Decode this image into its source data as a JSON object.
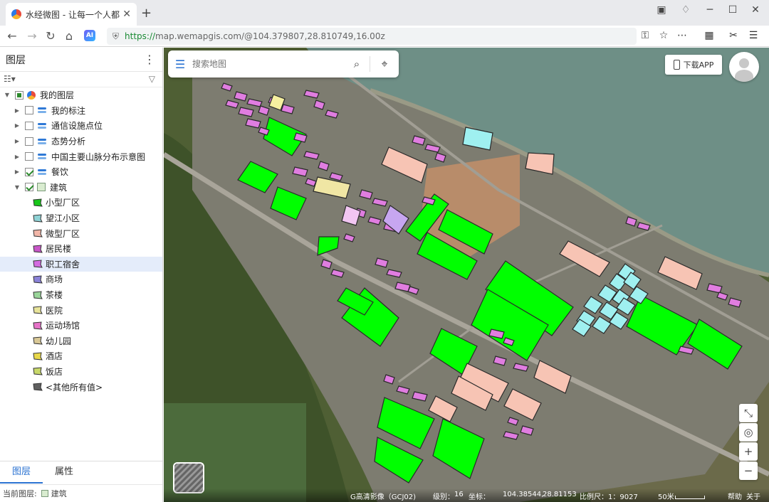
{
  "browser": {
    "tab_title": "水经微图 - 让每一个人都有自",
    "url_protocol": "https://",
    "url_rest": "map.wemapgis.com/@104.379807,28.810749,16.00z",
    "ai_badge": "AI"
  },
  "panel": {
    "title": "图层",
    "tree": [
      {
        "label": "我的图层",
        "level": 0,
        "check": "part",
        "icon": "globe"
      },
      {
        "label": "我的标注",
        "level": 1,
        "check": "off",
        "icon": "layer"
      },
      {
        "label": "通信设施点位",
        "level": 1,
        "check": "off",
        "icon": "layer"
      },
      {
        "label": "态势分析",
        "level": 1,
        "check": "off",
        "icon": "layer"
      },
      {
        "label": "中国主要山脉分布示意图",
        "level": 1,
        "check": "off",
        "icon": "layer"
      },
      {
        "label": "餐饮",
        "level": 1,
        "check": "on",
        "icon": "layer"
      },
      {
        "label": "建筑",
        "level": 1,
        "check": "on",
        "icon": "building"
      }
    ],
    "legend": [
      {
        "label": "小型厂区",
        "color": "#18c61a"
      },
      {
        "label": "望江小区",
        "color": "#8fd3d6"
      },
      {
        "label": "微型厂区",
        "color": "#f2b6a8"
      },
      {
        "label": "居民楼",
        "color": "#c857c8"
      },
      {
        "label": "职工宿舍",
        "color": "#d36be0"
      },
      {
        "label": "商场",
        "color": "#8a82d8"
      },
      {
        "label": "茶楼",
        "color": "#9ad59a"
      },
      {
        "label": "医院",
        "color": "#e8e49a"
      },
      {
        "label": "运动场馆",
        "color": "#e673c8"
      },
      {
        "label": "幼儿园",
        "color": "#d9c896"
      },
      {
        "label": "酒店",
        "color": "#e8d84a"
      },
      {
        "label": "饭店",
        "color": "#c8d86a"
      },
      {
        "label": "<其他所有值>",
        "color": "#606060"
      }
    ],
    "tabs": [
      "图层",
      "属性"
    ],
    "status_label": "当前图层:",
    "status_layer": "建筑"
  },
  "map": {
    "search_placeholder": "搜索地图",
    "download_label": "下载APP",
    "status": {
      "source": "G高清影像（GCJ02)",
      "level_label": "级别：",
      "level": "16",
      "coord_label": "坐标：",
      "lon": "104.38544,",
      "lat": "28.81153",
      "scale_label": "比例尺：1：9027",
      "scale_text": "50米",
      "help": "帮助",
      "about": "关于"
    },
    "colors": {
      "factory_green": "#00ff00",
      "dorm_pink": "#e07de0",
      "micro_factory": "#f7c4b4",
      "river": "#6e8f86"
    }
  }
}
